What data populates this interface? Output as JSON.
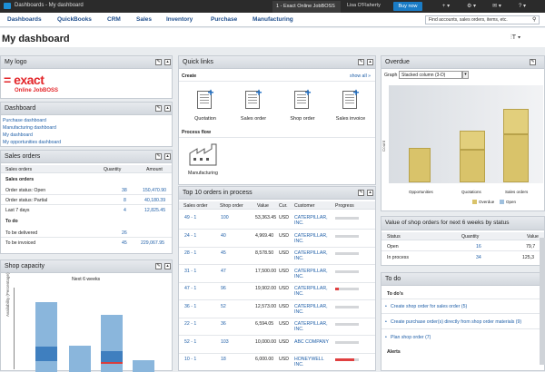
{
  "topbar": {
    "crumb": "Dashboards - My dashboard",
    "tab": "1 - Exact Online JobBOSS",
    "user": "Lisa O'Flaherty",
    "buy_now": "Buy now",
    "icons": [
      "home-icon",
      "plus-icon",
      "tools-icon",
      "mail-icon",
      "help-icon"
    ]
  },
  "menu": {
    "items": [
      "Dashboards",
      "QuickBooks",
      "CRM",
      "Sales",
      "Inventory",
      "Purchase",
      "Manufacturing"
    ],
    "search_placeholder": "Find accounts, sales orders, items, etc."
  },
  "page": {
    "title": "My dashboard"
  },
  "mylogo": {
    "title": "My logo",
    "logo_text": "= exact",
    "logo_sub": "Online JobBOSS"
  },
  "dashboard_panel": {
    "title": "Dashboard",
    "links": [
      "Purchase dashboard",
      "Manufacturing dashboard",
      "My dashboard",
      "My opportunities dashboard"
    ]
  },
  "sales_orders": {
    "title": "Sales orders",
    "headers": [
      "Sales orders",
      "Quantity",
      "Amount"
    ],
    "section1": "Sales orders",
    "rows1": [
      {
        "label": "Order status: Open",
        "qty": "38",
        "amount": "150,470.90"
      },
      {
        "label": "Order status: Partial",
        "qty": "8",
        "amount": "40,180.39"
      },
      {
        "label": "Last 7 days",
        "qty": "4",
        "amount": "12,825.45"
      }
    ],
    "section2": "To do",
    "rows2": [
      {
        "label": "To be delivered",
        "qty": "26",
        "amount": ""
      },
      {
        "label": "To be invoiced",
        "qty": "45",
        "amount": "229,067.95"
      }
    ]
  },
  "shop_capacity": {
    "title": "Shop capacity",
    "subtitle": "Next 6 weeks",
    "ylabel": "Availability (Percentage)"
  },
  "quick_links": {
    "title": "Quick links",
    "show_all": "show all »",
    "create_label": "Create",
    "items": [
      "Quotation",
      "Sales order",
      "Shop order",
      "Sales invoice"
    ],
    "process_label": "Process flow",
    "process_item": "Manufacturing"
  },
  "top10": {
    "title": "Top 10 orders in process",
    "headers": [
      "Sales order",
      "Shop order",
      "Value",
      "Cur.",
      "Customer",
      "Progress"
    ],
    "rows": [
      {
        "so": "49 - 1",
        "shop": "100",
        "value": "53,363.45",
        "cur": "USD",
        "cust": "CATERPILLAR, INC.",
        "progress": 0.0
      },
      {
        "so": "24 - 1",
        "shop": "40",
        "value": "4,969.40",
        "cur": "USD",
        "cust": "CATERPILLAR, INC.",
        "progress": 0.0
      },
      {
        "so": "28 - 1",
        "shop": "45",
        "value": "8,578.50",
        "cur": "USD",
        "cust": "CATERPILLAR, INC.",
        "progress": 0.0
      },
      {
        "so": "31 - 1",
        "shop": "47",
        "value": "17,500.00",
        "cur": "USD",
        "cust": "CATERPILLAR, INC.",
        "progress": 0.0
      },
      {
        "so": "47 - 1",
        "shop": "96",
        "value": "19,902.00",
        "cur": "USD",
        "cust": "CATERPILLAR, INC.",
        "progress": 0.15
      },
      {
        "so": "36 - 1",
        "shop": "52",
        "value": "12,573.00",
        "cur": "USD",
        "cust": "CATERPILLAR, INC.",
        "progress": 0.0
      },
      {
        "so": "22 - 1",
        "shop": "36",
        "value": "6,594.05",
        "cur": "USD",
        "cust": "CATERPILLAR, INC.",
        "progress": 0.0
      },
      {
        "so": "52 - 1",
        "shop": "103",
        "value": "10,000.00",
        "cur": "USD",
        "cust": "ABC COMPANY",
        "progress": 0.0
      },
      {
        "so": "10 - 1",
        "shop": "18",
        "value": "6,000.00",
        "cur": "USD",
        "cust": "HONEYWELL INC.",
        "progress": 0.8
      }
    ]
  },
  "overdue": {
    "title": "Overdue",
    "graph_label": "Graph",
    "graph_type": "Stacked column (3-D)",
    "ylabel": "Count",
    "categories": [
      "Opportunities",
      "Quotations",
      "Sales orders"
    ],
    "legend": [
      "Overdue",
      "Open"
    ],
    "colors": {
      "overdue": "#d9c36a",
      "open": "#9fc0de"
    }
  },
  "shop_value": {
    "title": "Value of shop orders for next 6 weeks by status",
    "headers": [
      "Status",
      "Quantity",
      "Value"
    ],
    "rows": [
      {
        "status": "Open",
        "qty": "16",
        "value": "79,7"
      },
      {
        "status": "In process",
        "qty": "34",
        "value": "125,3"
      }
    ]
  },
  "todo": {
    "title": "To do",
    "section": "To do's",
    "items": [
      "Create shop order for sales order (5)",
      "Create purchase order(s) directly from shop order materials (9)",
      "Plan shop order (7)"
    ],
    "alerts_label": "Alerts"
  }
}
